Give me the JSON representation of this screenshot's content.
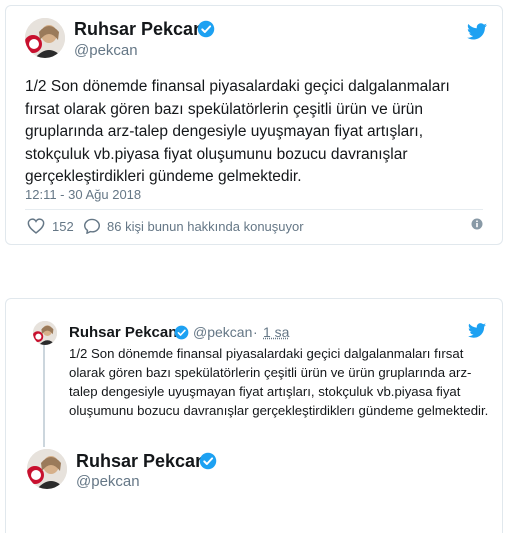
{
  "colors": {
    "twitter_blue": "#1da1f2",
    "text_primary": "#14171a",
    "text_secondary": "#657786",
    "border": "#e1e8ed"
  },
  "tweet": {
    "author_name": "Ruhsar Pekcan",
    "handle": "@pekcan",
    "text": "1/2 Son dönemde finansal piyasalardaki geçici dalgalanmaları fırsat olarak gören bazı spekülatörlerin çeşitli ürün ve ürün gruplarında  arz-talep dengesiyle uyuşmayan  fiyat artışları, stokçuluk vb.piyasa fiyat oluşumunu bozucu davranışlar gerçekleştirdikleri gündeme gelmektedir.",
    "timestamp": "12:11 - 30 Ağu 2018",
    "like_count": "152",
    "talk_text": "86 kişi bunun hakkında konuşuyor",
    "icons": [
      "twitter-bird-icon",
      "verified-icon",
      "heart-icon",
      "speech-bubble-icon",
      "info-icon"
    ]
  },
  "embedded": {
    "author_name": "Ruhsar Pekcan",
    "handle": "@pekcan",
    "separator": "·",
    "time_ago": "1 sa",
    "text": "1/2 Son dönemde finansal piyasalardaki geçici dalgalanmaları fırsat olarak gören bazı spekülatörlerin çeşitli ürün ve ürün gruplarında  arz-talep dengesiyle uyuşmayan  fiyat artışları, stokçuluk vb.piyasa fiyat oluşumunu bozucu davranışlar gerçekleştirdiklerı gündeme gelmektedir.",
    "reply_author_name": "Ruhsar Pekcan",
    "reply_handle": "@pekcan"
  }
}
